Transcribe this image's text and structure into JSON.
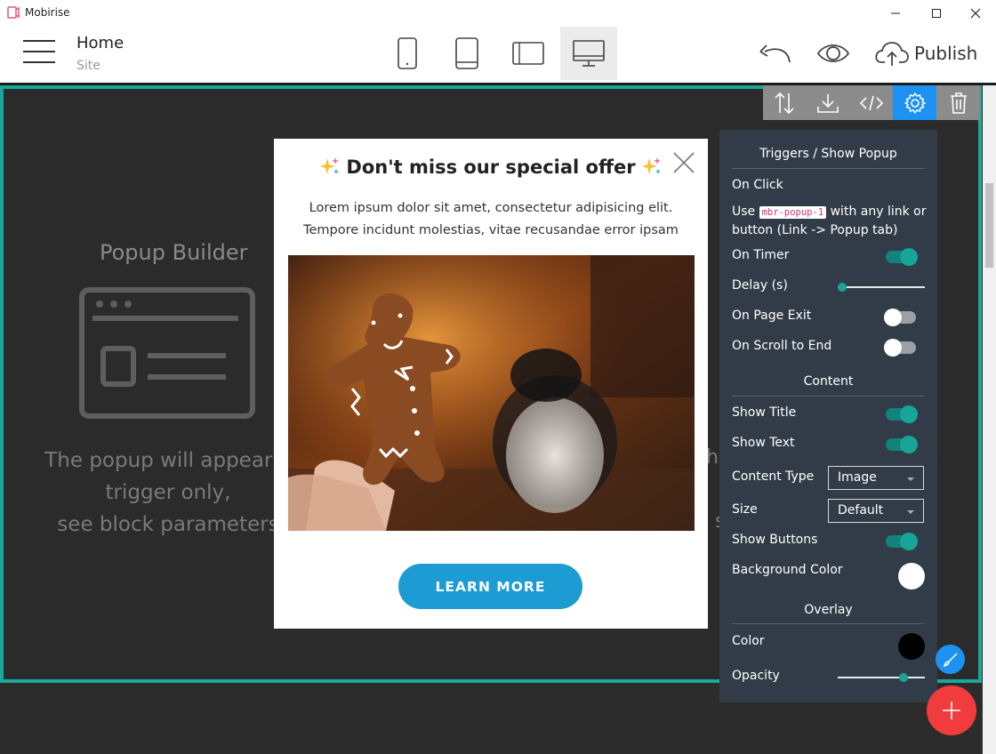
{
  "window": {
    "title": "Mobirise",
    "colors": {
      "brand_icon": "#e8508a"
    }
  },
  "toolbar": {
    "page_title": "Home",
    "page_subtitle": "Site",
    "devices": [
      {
        "icon": "phone-portrait-icon",
        "active": false
      },
      {
        "icon": "tablet-portrait-icon",
        "active": false
      },
      {
        "icon": "tablet-landscape-icon",
        "active": false
      },
      {
        "icon": "desktop-icon",
        "active": true
      }
    ],
    "publish_label": "Publish"
  },
  "block": {
    "border_color": "#1aa89a",
    "title": "Popup Builder",
    "text_lines": [
      "The popup will appear o",
      "trigger only,",
      "see block parameters"
    ],
    "right_fragments": [
      "h",
      "n",
      "s"
    ],
    "actions": [
      {
        "icon": "sort-arrows-icon",
        "active": false
      },
      {
        "icon": "download-icon",
        "active": false
      },
      {
        "icon": "code-icon",
        "active": false
      },
      {
        "icon": "gear-icon",
        "active": true
      },
      {
        "icon": "trash-icon",
        "active": false
      }
    ]
  },
  "popup": {
    "title": "Don't miss our special offer",
    "text_line1": "Lorem ipsum dolor sit amet, consectetur adipisicing elit.",
    "text_line2": "Tempore incidunt molestias, vitae recusandae error ipsam",
    "button_label": "LEARN MORE",
    "button_color": "#1d9bd3"
  },
  "panel": {
    "triggers_heading": "Triggers / Show Popup",
    "on_click_label": "On Click",
    "on_click_note_prefix": "Use",
    "on_click_code": "mbr-popup-1",
    "on_click_note_suffix": "with any link or",
    "on_click_note_line2": "button (Link -> Popup tab)",
    "on_timer_label": "On Timer",
    "on_timer": true,
    "delay_label": "Delay (s)",
    "delay_value": 0,
    "on_page_exit_label": "On Page Exit",
    "on_page_exit": false,
    "on_scroll_label": "On Scroll to End",
    "on_scroll": false,
    "content_heading": "Content",
    "show_title_label": "Show Title",
    "show_title": true,
    "show_text_label": "Show Text",
    "show_text": true,
    "content_type_label": "Content Type",
    "content_type_value": "Image",
    "size_label": "Size",
    "size_value": "Default",
    "show_buttons_label": "Show Buttons",
    "show_buttons": true,
    "bg_color_label": "Background Color",
    "bg_color": "#ffffff",
    "overlay_heading": "Overlay",
    "color_label": "Color",
    "overlay_color": "#000000",
    "opacity_label": "Opacity",
    "opacity_fraction": 0.76
  },
  "fabs": {
    "edit_icon": "brush-icon",
    "add_icon": "plus-icon",
    "add_color": "#f03c3c"
  }
}
